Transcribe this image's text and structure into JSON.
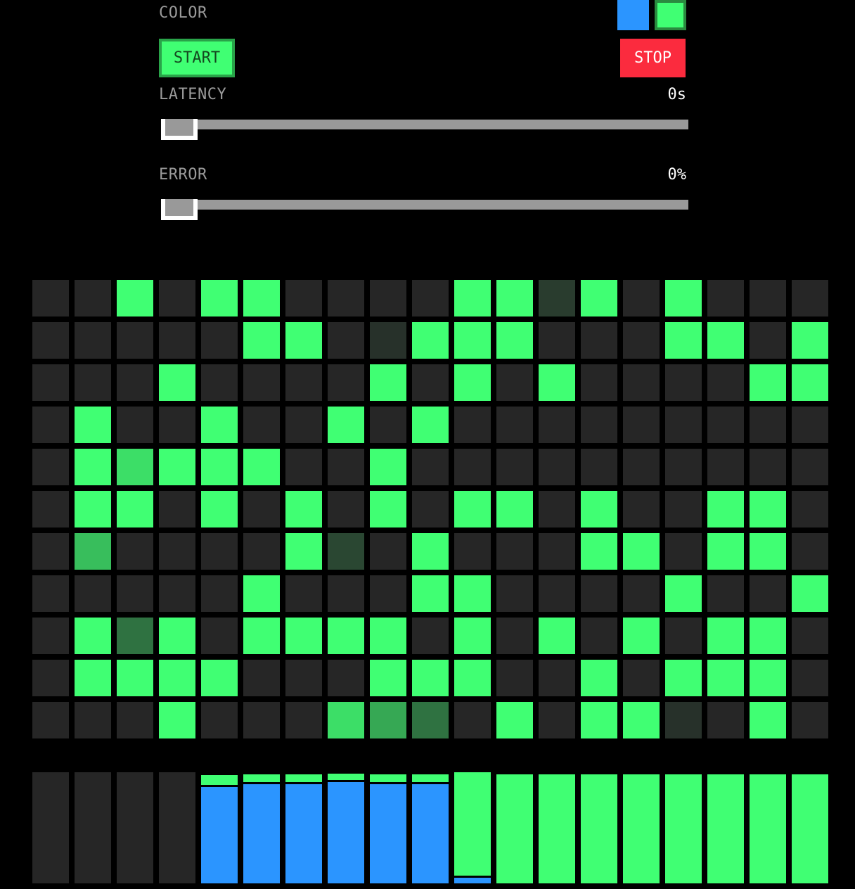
{
  "controls": {
    "color_label": "COLOR",
    "colors": [
      {
        "name": "blue",
        "hex": "#2b95ff",
        "selected": false
      },
      {
        "name": "green",
        "hex": "#40ff73",
        "selected": true
      }
    ],
    "start_label": "START",
    "stop_label": "STOP",
    "latency": {
      "label": "LATENCY",
      "value_text": "0s",
      "fraction": 0.0
    },
    "error": {
      "label": "ERROR",
      "value_text": "0%",
      "fraction": 0.0
    }
  },
  "palette": {
    "off": "#262626",
    "on": "#40ff73",
    "blue": "#2b95ff",
    "start_bg": "#40ff73",
    "start_border": "#29a349",
    "start_text": "#14471f",
    "stop_bg": "#fb2b3e",
    "stop_text": "#ffffff"
  },
  "grid": {
    "rows": [
      [
        0,
        0,
        1,
        0,
        1,
        1,
        0,
        0,
        0,
        0,
        1,
        1,
        0.1,
        1,
        0,
        1,
        0,
        0,
        0
      ],
      [
        0,
        0,
        0,
        0,
        0,
        1,
        1,
        0,
        0.05,
        1,
        1,
        1,
        0,
        0,
        0,
        1,
        1,
        0,
        1
      ],
      [
        0,
        0,
        0,
        1,
        0,
        0,
        0,
        0,
        1,
        0,
        1,
        0,
        1,
        0,
        0,
        0,
        0,
        1,
        1
      ],
      [
        0,
        1,
        0,
        0,
        1,
        0,
        0,
        1,
        0,
        1,
        0,
        0,
        0,
        0,
        0,
        0,
        0,
        0,
        0
      ],
      [
        0,
        1,
        0.85,
        1,
        1,
        1,
        0,
        0,
        1,
        0,
        0,
        0,
        0,
        0,
        0,
        0,
        0,
        0,
        0
      ],
      [
        0,
        1,
        1,
        0,
        1,
        0,
        1,
        0,
        1,
        0,
        1,
        1,
        0,
        1,
        0,
        0,
        1,
        1,
        0
      ],
      [
        0,
        0.7,
        0,
        0,
        0,
        0,
        1,
        0.15,
        0,
        1,
        0,
        0,
        0,
        1,
        1,
        0,
        1,
        1,
        0
      ],
      [
        0,
        0,
        0,
        0,
        0,
        1,
        0,
        0,
        0,
        1,
        1,
        0,
        0,
        0,
        0,
        1,
        0,
        0,
        1
      ],
      [
        0,
        1,
        0.35,
        1,
        0,
        1,
        1,
        1,
        1,
        0,
        1,
        0,
        1,
        0,
        1,
        0,
        1,
        1,
        0
      ],
      [
        0,
        1,
        1,
        1,
        1,
        0,
        0,
        0,
        1,
        1,
        1,
        0,
        0,
        1,
        0,
        1,
        1,
        1,
        0
      ],
      [
        0,
        0,
        0,
        1,
        0,
        0,
        0,
        0.85,
        0.6,
        0.35,
        0,
        1,
        0,
        1,
        1,
        0.05,
        0,
        1,
        0
      ]
    ]
  },
  "bars": [
    {
      "green": 0,
      "blue": 0
    },
    {
      "green": 0,
      "blue": 0
    },
    {
      "green": 0,
      "blue": 0
    },
    {
      "green": 0,
      "blue": 0
    },
    {
      "green": 0.09,
      "blue": 0.87
    },
    {
      "green": 0.07,
      "blue": 0.89
    },
    {
      "green": 0.07,
      "blue": 0.89
    },
    {
      "green": 0.06,
      "blue": 0.91
    },
    {
      "green": 0.07,
      "blue": 0.89
    },
    {
      "green": 0.07,
      "blue": 0.89
    },
    {
      "green": 0.93,
      "blue": 0.05
    },
    {
      "green": 0.98,
      "blue": 0
    },
    {
      "green": 0.98,
      "blue": 0
    },
    {
      "green": 0.98,
      "blue": 0
    },
    {
      "green": 0.98,
      "blue": 0
    },
    {
      "green": 0.98,
      "blue": 0
    },
    {
      "green": 0.98,
      "blue": 0
    },
    {
      "green": 0.98,
      "blue": 0
    },
    {
      "green": 0.98,
      "blue": 0
    }
  ]
}
